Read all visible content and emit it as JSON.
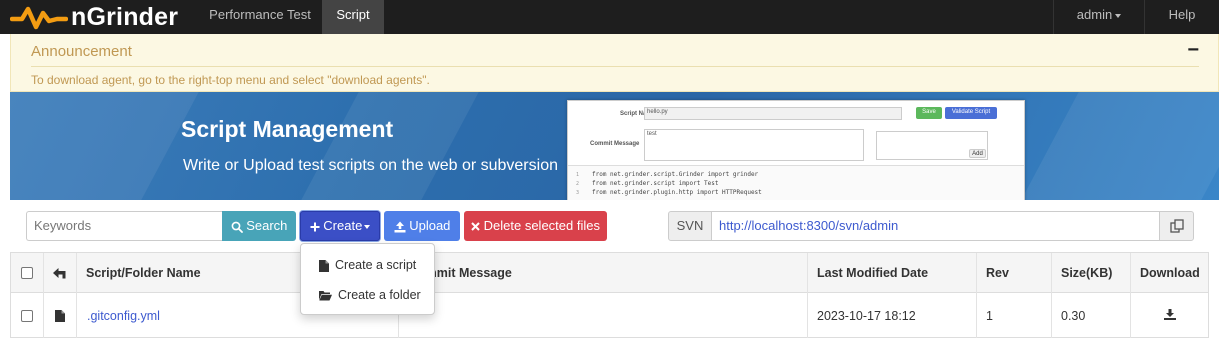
{
  "app": {
    "brand": "nGrinder"
  },
  "nav": {
    "tabs": [
      {
        "label": "Performance Test",
        "active": false
      },
      {
        "label": "Script",
        "active": true
      }
    ],
    "user_menu": "admin",
    "help": "Help"
  },
  "announcement": {
    "title": "Announcement",
    "collapse_symbol": "−",
    "message": "To download agent, go to the right-top menu and select \"download agents\"."
  },
  "banner": {
    "title": "Script Management",
    "subtitle": "Write or Upload test scripts on the web or subversion",
    "preview": {
      "script_name_label": "Script Name",
      "script_name_value": "hello.py",
      "save_label": "Save",
      "validate_label": "Validate Script",
      "commit_label": "Commit Message",
      "commit_value": "test",
      "add_label": "Add",
      "code_lines": [
        {
          "num": "1",
          "text": "from net.grinder.script.Grinder import grinder"
        },
        {
          "num": "2",
          "text": "from net.grinder.script import Test"
        },
        {
          "num": "3",
          "text": "from net.grinder.plugin.http import HTTPRequest"
        }
      ]
    }
  },
  "toolbar": {
    "search_placeholder": "Keywords",
    "search_label": "Search",
    "create_label": "Create",
    "upload_label": "Upload",
    "delete_label": "Delete selected files",
    "svn_label": "SVN",
    "svn_url": "http://localhost:8300/svn/admin"
  },
  "create_menu": {
    "items": [
      {
        "label": "Create a script",
        "icon": "file-icon"
      },
      {
        "label": "Create a folder",
        "icon": "folder-open-icon"
      }
    ]
  },
  "table": {
    "columns": {
      "name": "Script/Folder Name",
      "commit": "Commit Message",
      "modified": "Last Modified Date",
      "rev": "Rev",
      "size": "Size(KB)",
      "download": "Download"
    },
    "rows": [
      {
        "name": ".gitconfig.yml",
        "commit": "",
        "modified": "2023-10-17 18:12",
        "rev": "1",
        "size": "0.30",
        "icon": "file-icon",
        "download_icon": "download-icon"
      }
    ]
  },
  "colors": {
    "navbar": "#1e1e1e",
    "announcement_bg": "#fcf8e3",
    "announcement_text": "#c09853",
    "search_button": "#48a4b8",
    "create_button": "#3b4fc6",
    "upload_button": "#4f7fe8",
    "delete_button": "#d9414b",
    "link": "#3d5acf"
  }
}
